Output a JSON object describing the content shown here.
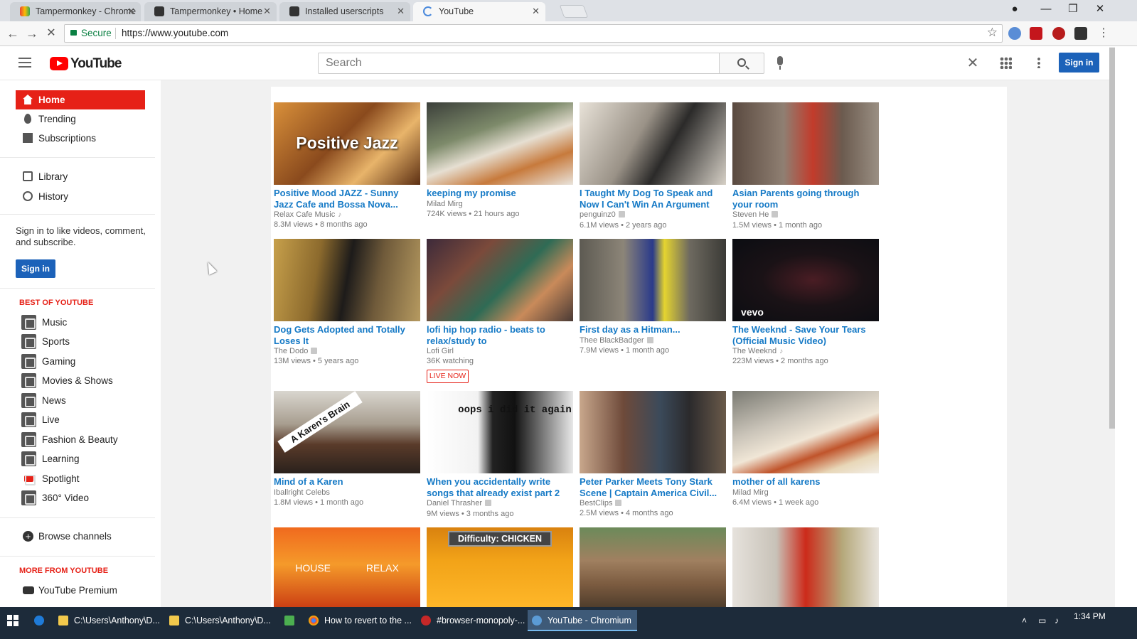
{
  "browser": {
    "tabs": [
      {
        "title": "Tampermonkey - Chrome"
      },
      {
        "title": "Tampermonkey • Home"
      },
      {
        "title": "Installed userscripts"
      },
      {
        "title": "YouTube"
      }
    ],
    "secure_label": "Secure",
    "url": "https://www.youtube.com"
  },
  "masthead": {
    "logo_text": "YouTube",
    "search_placeholder": "Search",
    "signin_label": "Sign in"
  },
  "guide": {
    "nav": [
      "Home",
      "Trending",
      "Subscriptions"
    ],
    "library": [
      "Library",
      "History"
    ],
    "signin_prompt": "Sign in to like videos, comment, and subscribe.",
    "signin_label": "Sign in",
    "best_heading": "BEST OF YOUTUBE",
    "best_items": [
      "Music",
      "Sports",
      "Gaming",
      "Movies & Shows",
      "News",
      "Live",
      "Fashion & Beauty",
      "Learning",
      "Spotlight",
      "360° Video"
    ],
    "browse_channels": "Browse channels",
    "more_heading": "MORE FROM YOUTUBE",
    "more_items": [
      "YouTube Premium"
    ]
  },
  "videos": [
    {
      "title": "Positive Mood JAZZ - Sunny Jazz Cafe and Bossa Nova...",
      "channel": "Relax Cafe Music",
      "stats": "8.3M views • 8 months ago",
      "overlay": "Positive Jazz"
    },
    {
      "title": "keeping my promise",
      "channel": "Milad Mirg",
      "stats": "724K views • 21 hours ago"
    },
    {
      "title": "I Taught My Dog To Speak and Now I Can't Win An Argument",
      "channel": "penguinz0",
      "stats": "6.1M views • 2 years ago"
    },
    {
      "title": "Asian Parents going through your room",
      "channel": "Steven He",
      "stats": "1.5M views • 1 month ago"
    },
    {
      "title": "Dog Gets Adopted and Totally Loses It",
      "channel": "The Dodo",
      "stats": "13M views • 5 years ago"
    },
    {
      "title": "lofi hip hop radio - beats to relax/study to",
      "channel": "Lofi Girl",
      "stats": "36K watching",
      "badge": "LIVE NOW"
    },
    {
      "title": "First day as a Hitman...",
      "channel": "Thee BlackBadger",
      "stats": "7.9M views • 1 month ago"
    },
    {
      "title": "The Weeknd - Save Your Tears (Official Music Video)",
      "channel": "The Weeknd",
      "stats": "223M views • 2 months ago",
      "overlay": "vevo"
    },
    {
      "title": "Mind of a Karen",
      "channel": "Iballright Celebs",
      "stats": "1.8M views • 1 month ago",
      "overlay": "A Karen's Brain"
    },
    {
      "title": "When you accidentally write songs that already exist part 2",
      "channel": "Daniel Thrasher",
      "stats": "9M views • 3 months ago",
      "overlay": "oops i did it again"
    },
    {
      "title": "Peter Parker Meets Tony Stark Scene | Captain America Civil...",
      "channel": "BestClips",
      "stats": "2.5M views • 4 months ago"
    },
    {
      "title": "mother of all karens",
      "channel": "Milad Mirg",
      "stats": "6.4M views • 1 week ago"
    },
    {
      "overlay": "HOUSE RELAX"
    },
    {
      "overlay": "Difficulty: CHICKEN"
    },
    {},
    {}
  ],
  "taskbar": {
    "items": [
      "C:\\Users\\Anthony\\D...",
      "C:\\Users\\Anthony\\D...",
      "How to revert to the ...",
      "#browser-monopoly-...",
      "YouTube - Chromium"
    ],
    "time": "1:34 PM"
  },
  "colors": {
    "accent_red": "#e62117",
    "link_blue": "#167ac6",
    "button_blue": "#1c62b9"
  }
}
